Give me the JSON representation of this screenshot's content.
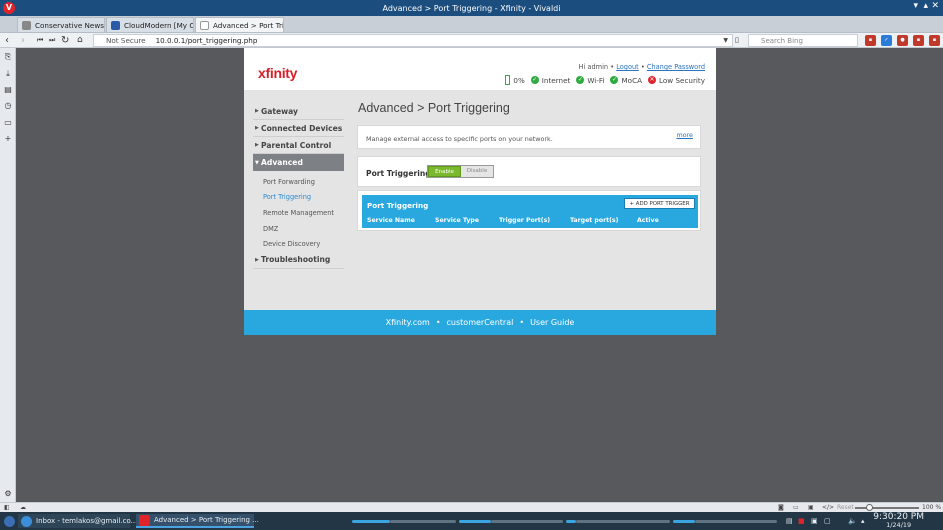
{
  "window": {
    "title": "Advanced > Port Triggering - Xfinity - Vivaldi",
    "logo": "V"
  },
  "tabs": [
    {
      "label": "Conservative News and",
      "color": "#888888"
    },
    {
      "label": "CloudModern [My Cloud",
      "color": "#2b5aa8"
    },
    {
      "label": "Advanced > Port Triggeri",
      "color": "#d9d9d9"
    }
  ],
  "address": {
    "security": "Not Secure",
    "url": "10.0.0.1/port_triggering.php",
    "search_placeholder": "Search Bing"
  },
  "header": {
    "logo": "xfinity",
    "greeting": "Hi admin",
    "logout": "Logout",
    "change_password": "Change Password",
    "battery": "0%",
    "status": [
      {
        "label": "Internet",
        "state": "ok"
      },
      {
        "label": "Wi-Fi",
        "state": "ok"
      },
      {
        "label": "MoCA",
        "state": "ok"
      },
      {
        "label": "Low Security",
        "state": "error"
      }
    ]
  },
  "nav": {
    "gateway": "Gateway",
    "connected_devices": "Connected Devices",
    "parental_control": "Parental Control",
    "advanced": "Advanced",
    "sub": [
      "Port Forwarding",
      "Port Triggering",
      "Remote Management",
      "DMZ",
      "Device Discovery"
    ],
    "troubleshooting": "Troubleshooting"
  },
  "main": {
    "title": "Advanced > Port Triggering",
    "description": "Manage external access to specific ports on your network.",
    "more": "more",
    "pt_label": "Port Triggering:",
    "enable": "Enable",
    "disable": "Disable",
    "table_title": "Port Triggering",
    "add_button": "+ ADD PORT TRIGGER",
    "columns": [
      "Service Name",
      "Service Type",
      "Trigger Port(s)",
      "Target port(s)",
      "Active"
    ]
  },
  "footer": {
    "links": [
      "Xfinity.com",
      "customerCentral",
      "User Guide"
    ],
    "sep": "•"
  },
  "statusbar": {
    "reset": "Reset",
    "zoom": "100 %"
  },
  "taskbar": {
    "items": [
      {
        "label": "Inbox - temlakos@gmail.co...",
        "color": "#3b8fd9"
      },
      {
        "label": "Advanced > Port Triggering ...",
        "color": "#e0242a"
      }
    ],
    "time": "9:30:20 PM",
    "date": "1/24/19"
  },
  "colors": {
    "accent": "#29a8e0",
    "enable": "#7ab82d",
    "ok": "#2eaa3e",
    "error": "#e0242a"
  }
}
